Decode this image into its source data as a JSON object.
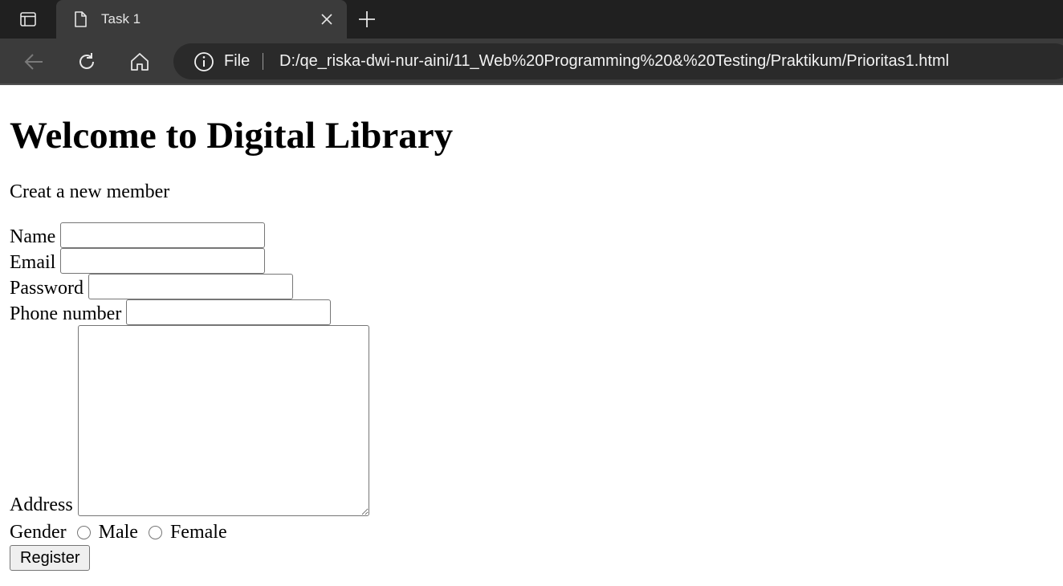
{
  "browser": {
    "tab": {
      "title": "Task 1"
    },
    "address_bar": {
      "scheme_label": "File",
      "url": "D:/qe_riska-dwi-nur-aini/11_Web%20Programming%20&%20Testing/Praktikum/Prioritas1.html"
    },
    "icons": {
      "tab_actions": "tab-actions-icon",
      "page": "page-icon",
      "close": "close-icon",
      "new_tab": "plus-icon",
      "back": "back-arrow-icon",
      "refresh": "refresh-icon",
      "home": "home-icon",
      "info": "info-icon"
    },
    "colors": {
      "tabbar": "#202020",
      "toolbar": "#3b3b3b",
      "address_bar": "#2a2a2a",
      "chrome_text": "#f2f2f2"
    }
  },
  "page": {
    "title": "Welcome to Digital Library",
    "intro": "Creat a new member",
    "form": {
      "name_label": "Name",
      "name_value": "",
      "email_label": "Email",
      "email_value": "",
      "password_label": "Password",
      "password_value": "",
      "phone_label": "Phone number",
      "phone_value": "",
      "address_label": "Address",
      "address_value": "",
      "gender_label": "Gender",
      "gender_options": [
        "Male",
        "Female"
      ],
      "register_label": "Register"
    }
  }
}
